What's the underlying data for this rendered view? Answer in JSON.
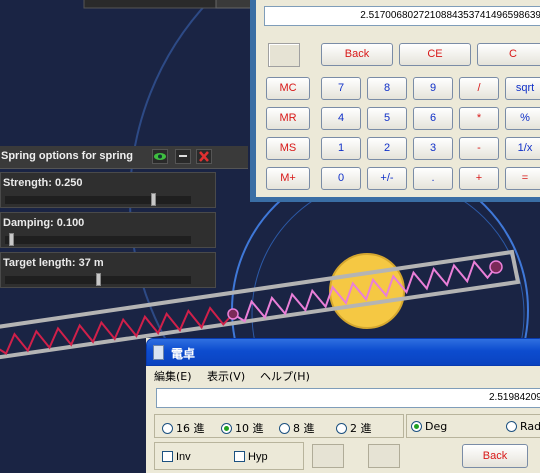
{
  "top_calculator": {
    "display": "2.5170068027210884353741496598639",
    "buttons": [
      {
        "id": "back",
        "label": "Back",
        "color": "red"
      },
      {
        "id": "ce",
        "label": "CE",
        "color": "red"
      },
      {
        "id": "c",
        "label": "C",
        "color": "red"
      },
      {
        "id": "mc",
        "label": "MC",
        "color": "red"
      },
      {
        "id": "mr",
        "label": "MR",
        "color": "red"
      },
      {
        "id": "ms",
        "label": "MS",
        "color": "red"
      },
      {
        "id": "mplus",
        "label": "M+",
        "color": "red"
      },
      {
        "id": "n7",
        "label": "7",
        "color": "blue"
      },
      {
        "id": "n8",
        "label": "8",
        "color": "blue"
      },
      {
        "id": "n9",
        "label": "9",
        "color": "blue"
      },
      {
        "id": "div",
        "label": "/",
        "color": "red"
      },
      {
        "id": "sqrt",
        "label": "sqrt",
        "color": "blue"
      },
      {
        "id": "n4",
        "label": "4",
        "color": "blue"
      },
      {
        "id": "n5",
        "label": "5",
        "color": "blue"
      },
      {
        "id": "n6",
        "label": "6",
        "color": "blue"
      },
      {
        "id": "mul",
        "label": "*",
        "color": "red"
      },
      {
        "id": "pct",
        "label": "%",
        "color": "blue"
      },
      {
        "id": "n1",
        "label": "1",
        "color": "blue"
      },
      {
        "id": "n2",
        "label": "2",
        "color": "blue"
      },
      {
        "id": "n3",
        "label": "3",
        "color": "blue"
      },
      {
        "id": "sub",
        "label": "-",
        "color": "red"
      },
      {
        "id": "inv",
        "label": "1/x",
        "color": "blue"
      },
      {
        "id": "n0",
        "label": "0",
        "color": "blue"
      },
      {
        "id": "sign",
        "label": "+/-",
        "color": "blue"
      },
      {
        "id": "dot",
        "label": ".",
        "color": "blue"
      },
      {
        "id": "add",
        "label": "+",
        "color": "red"
      },
      {
        "id": "eq",
        "label": "=",
        "color": "red"
      }
    ]
  },
  "spring_panel": {
    "title": "Spring options for spring",
    "icons": [
      "eye-icon",
      "minimize-icon",
      "close-icon"
    ],
    "rows": [
      {
        "label": "Strength: 0.250",
        "slider": 0.8
      },
      {
        "label": "Damping: 0.100",
        "slider": 0.02
      },
      {
        "label": "Target length: 37 m",
        "slider": 0.5
      }
    ]
  },
  "bottom_calculator": {
    "title": "電卓",
    "menu": [
      "編集(E)",
      "表示(V)",
      "ヘルプ(H)"
    ],
    "display": "2.51984209",
    "number_bases": [
      {
        "label": "16 進",
        "selected": false
      },
      {
        "label": "10 進",
        "selected": true
      },
      {
        "label": "8 進",
        "selected": false
      },
      {
        "label": "2 進",
        "selected": false
      }
    ],
    "angle_units": [
      {
        "label": "Deg",
        "selected": true
      },
      {
        "label": "Rad",
        "selected": false
      }
    ],
    "checkboxes": [
      "Inv",
      "Hyp"
    ],
    "back_label": "Back"
  },
  "colors": {
    "background": "#1a2444",
    "spring_zigzag": "#ea7fd8",
    "spring_zigzag_red": "#d0204a",
    "sun": "#f5c843",
    "calc_red": "#d81818",
    "calc_blue": "#1030c8"
  }
}
